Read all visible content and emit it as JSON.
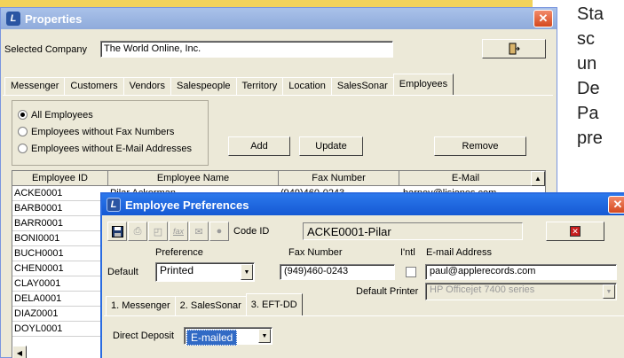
{
  "background_text": [
    "Sta",
    "sc",
    "un",
    "De",
    "Pa",
    "pre"
  ],
  "properties_window": {
    "title": "Properties",
    "app_icon": "L",
    "selected_company_label": "Selected Company",
    "selected_company_value": "The World Online, Inc.",
    "exit_icon": "door-exit-icon",
    "tabs": [
      "Messenger",
      "Customers",
      "Vendors",
      "Salespeople",
      "Territory",
      "Location",
      "SalesSonar",
      "Employees"
    ],
    "active_tab": "Employees",
    "filter_options": [
      "All Employees",
      "Employees without Fax Numbers",
      "Employees without E-Mail Addresses"
    ],
    "selected_filter": "All Employees",
    "buttons": {
      "add": "Add",
      "update": "Update",
      "remove": "Remove"
    },
    "table": {
      "columns": [
        "Employee ID",
        "Employee Name",
        "Fax Number",
        "E-Mail"
      ],
      "first_row": {
        "id": "ACKE0001",
        "name": "Pilar Ackerman",
        "fax": "(949)460-0243",
        "email": "barney@lisjones.com"
      },
      "ids": [
        "ACKE0001",
        "BARB0001",
        "BARR0001",
        "BONI0001",
        "BUCH0001",
        "CHEN0001",
        "CLAY0001",
        "DELA0001",
        "DIAZ0001",
        "DOYL0001"
      ]
    }
  },
  "employee_prefs_window": {
    "title": "Employee Preferences",
    "app_icon": "L",
    "toolbar_icons": [
      "save-icon",
      "print-icon",
      "preview-icon",
      "fax-icon",
      "email-icon",
      "help-icon"
    ],
    "fax_icon_label": "fax",
    "code_id_label": "Code ID",
    "code_id_value": "ACKE0001-Pilar",
    "preference_header": "Preference",
    "fax_header": "Fax Number",
    "intl_header": "I'ntl",
    "email_header": "E-mail Address",
    "default_label": "Default",
    "preference_value": "Printed",
    "fax_value": "(949)460-0243",
    "email_value": "paul@applerecords.com",
    "default_printer_label": "Default Printer",
    "default_printer_value": "HP Officejet 7400 series",
    "subtabs": [
      "1. Messenger",
      "2. SalesSonar",
      "3. EFT-DD"
    ],
    "active_subtab": "3. EFT-DD",
    "direct_deposit_label": "Direct Deposit",
    "direct_deposit_value": "E-mailed"
  }
}
